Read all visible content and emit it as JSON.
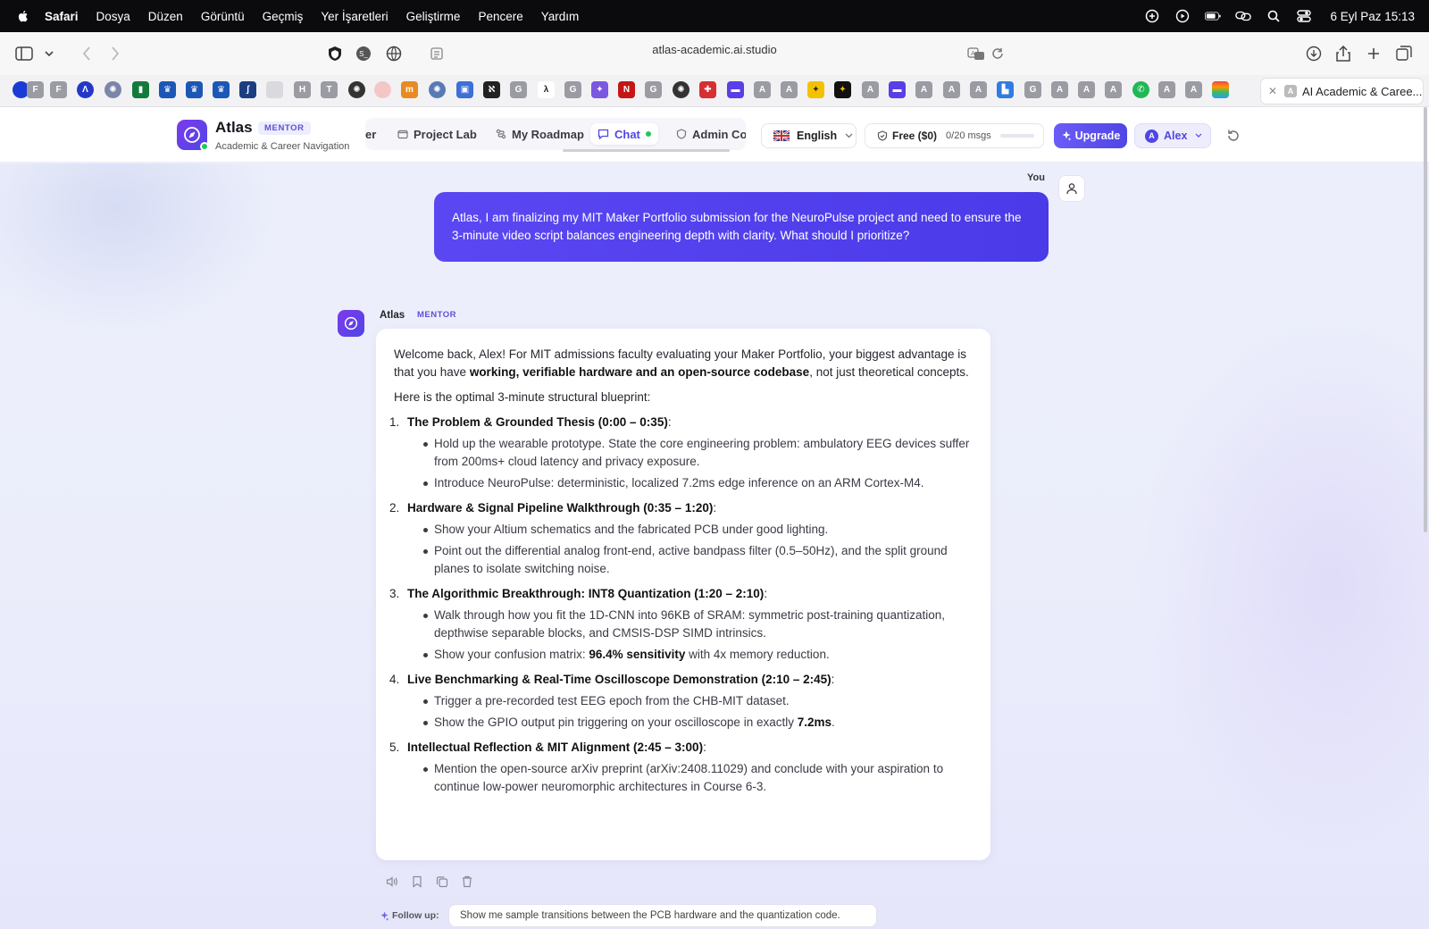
{
  "menubar": {
    "items": [
      "Safari",
      "Dosya",
      "Düzen",
      "Görüntü",
      "Geçmiş",
      "Yer İşaretleri",
      "Geliştirme",
      "Pencere",
      "Yardım"
    ],
    "clock": "6 Eyl Paz  15:13"
  },
  "browser": {
    "url": "atlas-academic.ai.studio",
    "active_tab_title": "AI Academic & Caree...",
    "favorites": [
      "F",
      "F",
      "H",
      "T",
      "G",
      "G",
      "G",
      "A",
      "A",
      "A",
      "A",
      "A",
      "A",
      "G",
      "A",
      "A",
      "A",
      "A",
      "A"
    ]
  },
  "header": {
    "brand": "Atlas",
    "badge": "MENTOR",
    "subtitle": "Academic & Career Navigation",
    "tabs": [
      {
        "label": "er",
        "active": false
      },
      {
        "label": "Project Lab",
        "active": false
      },
      {
        "label": "My Roadmap",
        "active": false
      },
      {
        "label": "Chat",
        "active": true
      },
      {
        "label": "Admin Con",
        "active": false
      }
    ],
    "language": "English",
    "plan": {
      "label": "Free ($0)",
      "messages": "0/20 msgs",
      "used_fraction": 0
    },
    "upgrade_label": "Upgrade",
    "user_initial": "A",
    "user_name": "Alex"
  },
  "chat": {
    "user_label": "You",
    "user_message": "Atlas, I am finalizing my MIT Maker Portfolio submission for the NeuroPulse project and need to ensure the 3-minute video script balances engineering depth with clarity. What should I prioritize?",
    "bot_name": "Atlas",
    "bot_badge": "MENTOR",
    "intro_before": "Welcome back, Alex! For MIT admissions faculty evaluating your Maker Portfolio, your biggest advantage is that you have ",
    "intro_bold": "working, verifiable hardware and an open-source codebase",
    "intro_after": ", not just theoretical concepts.",
    "blueprint_line": "Here is the optimal 3-minute structural blueprint:",
    "sections": [
      {
        "num": "1.",
        "title": "The Problem & Grounded Thesis (0:00 – 0:35)",
        "bullets": [
          "Hold up the wearable prototype. State the core engineering problem: ambulatory EEG devices suffer from 200ms+ cloud latency and privacy exposure.",
          "Introduce NeuroPulse: deterministic, localized 7.2ms edge inference on an ARM Cortex-M4."
        ]
      },
      {
        "num": "2.",
        "title": "Hardware & Signal Pipeline Walkthrough (0:35 – 1:20)",
        "bullets": [
          "Show your Altium schematics and the fabricated PCB under good lighting.",
          "Point out the differential analog front-end, active bandpass filter (0.5–50Hz), and the split ground planes to isolate switching noise."
        ]
      },
      {
        "num": "3.",
        "title": "The Algorithmic Breakthrough: INT8 Quantization (1:20 – 2:10)",
        "bullets": [
          "Walk through how you fit the 1D-CNN into 96KB of SRAM: symmetric post-training quantization, depthwise separable blocks, and CMSIS-DSP SIMD intrinsics."
        ],
        "extra": {
          "before": "Show your confusion matrix: ",
          "bold": "96.4% sensitivity",
          "after": " with 4x memory reduction."
        }
      },
      {
        "num": "4.",
        "title": "Live Benchmarking & Real-Time Oscilloscope Demonstration (2:10 – 2:45)",
        "bullets": [
          "Trigger a pre-recorded test EEG epoch from the CHB-MIT dataset."
        ],
        "extra": {
          "before": "Show the GPIO output pin triggering on your oscilloscope in exactly ",
          "bold": "7.2ms",
          "after": "."
        }
      },
      {
        "num": "5.",
        "title": "Intellectual Reflection & MIT Alignment (2:45 – 3:00)",
        "bullets": [
          "Mention the open-source arXiv preprint (arXiv:2408.11029) and conclude with your aspiration to continue low-power neuromorphic architectures in Course 6-3."
        ]
      }
    ],
    "follow_up_label": "Follow up:",
    "follow_up_suggestion": "Show me sample transitions between the PCB hardware and the quantization code."
  }
}
